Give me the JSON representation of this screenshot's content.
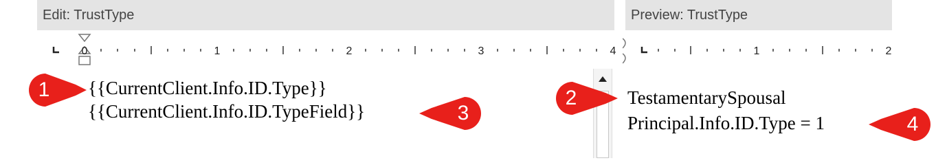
{
  "edit_pane": {
    "title": "Edit: TrustType",
    "ruler_numbers": [
      "0",
      "1",
      "2",
      "3",
      "4"
    ],
    "lines": [
      "{{CurrentClient.Info.ID.Type}}",
      "{{CurrentClient.Info.ID.TypeField}}"
    ]
  },
  "preview_pane": {
    "title": "Preview: TrustType",
    "ruler_numbers": [
      "1",
      "2"
    ],
    "lines": [
      "TestamentarySpousal",
      "Principal.Info.ID.Type = 1"
    ]
  },
  "callouts": [
    "1",
    "2",
    "3",
    "4"
  ],
  "colors": {
    "callout_red": "#e8201b",
    "header_bg": "#e4e4e4"
  }
}
